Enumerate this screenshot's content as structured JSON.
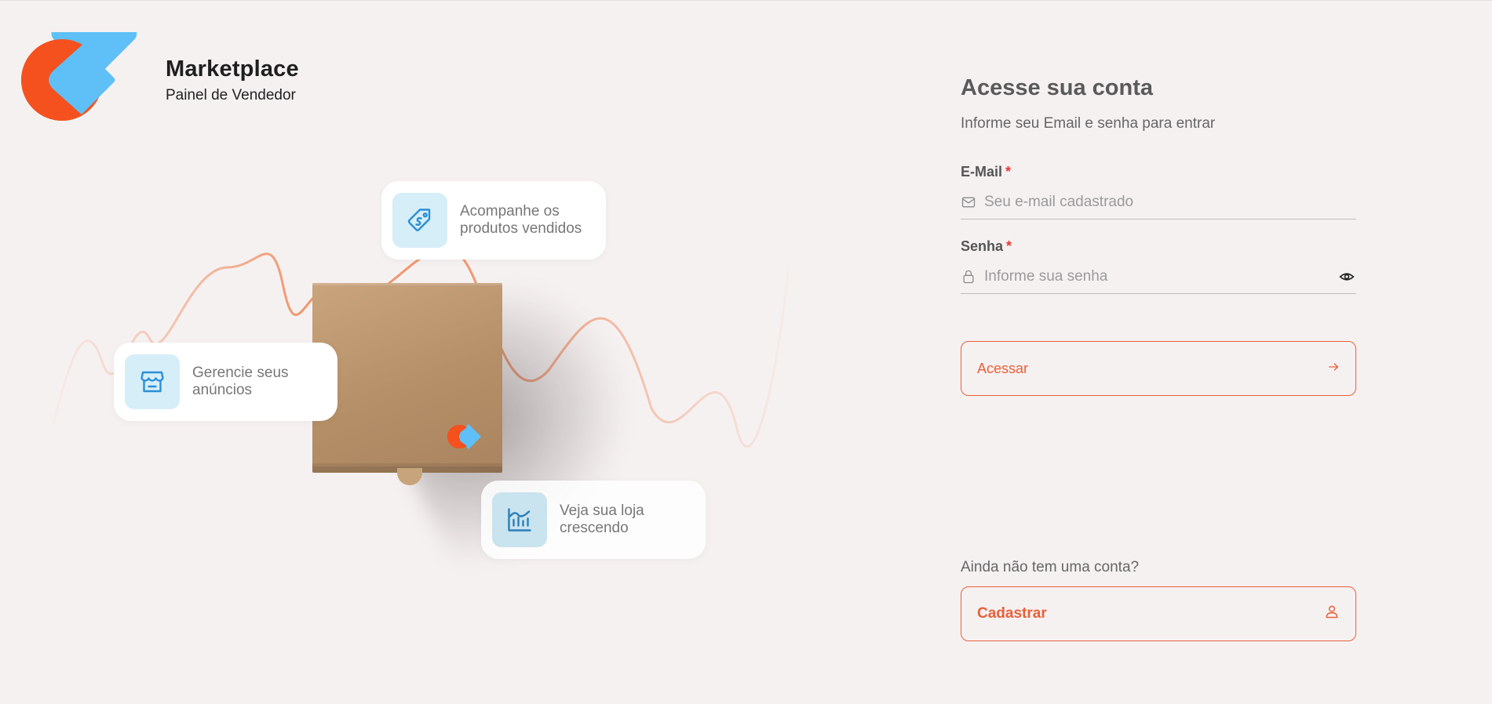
{
  "brand": {
    "name": "Marketplace",
    "subtitle": "Painel de Vendedor",
    "colors": {
      "orange": "#f4511e",
      "blue": "#5ec0f7"
    }
  },
  "hero": {
    "cards": [
      {
        "label": "Acompanhe os produtos vendidos",
        "icon": "price-tag-icon"
      },
      {
        "label": "Gerencie seus anúncios",
        "icon": "store-icon"
      },
      {
        "label": "Veja sua loja crescendo",
        "icon": "growth-chart-icon"
      }
    ],
    "accent": "#f08a5d"
  },
  "login": {
    "title": "Acesse sua conta",
    "subtitle": "Informe seu Email e senha para entrar",
    "email": {
      "label": "E-Mail",
      "required_mark": "*",
      "placeholder": "Seu e-mail cadastrado",
      "icon": "mail-icon"
    },
    "password": {
      "label": "Senha",
      "required_mark": "*",
      "placeholder": "Informe sua senha",
      "icon": "lock-icon",
      "toggle_icon": "eye-icon"
    },
    "submit_label": "Acessar",
    "submit_icon": "arrow-right-icon"
  },
  "signup": {
    "prompt": "Ainda não tem uma conta?",
    "button_label": "Cadastrar",
    "button_icon": "user-icon"
  },
  "colors": {
    "accent": "#e8603a",
    "required": "#e53935",
    "background": "#f6f1f1"
  }
}
